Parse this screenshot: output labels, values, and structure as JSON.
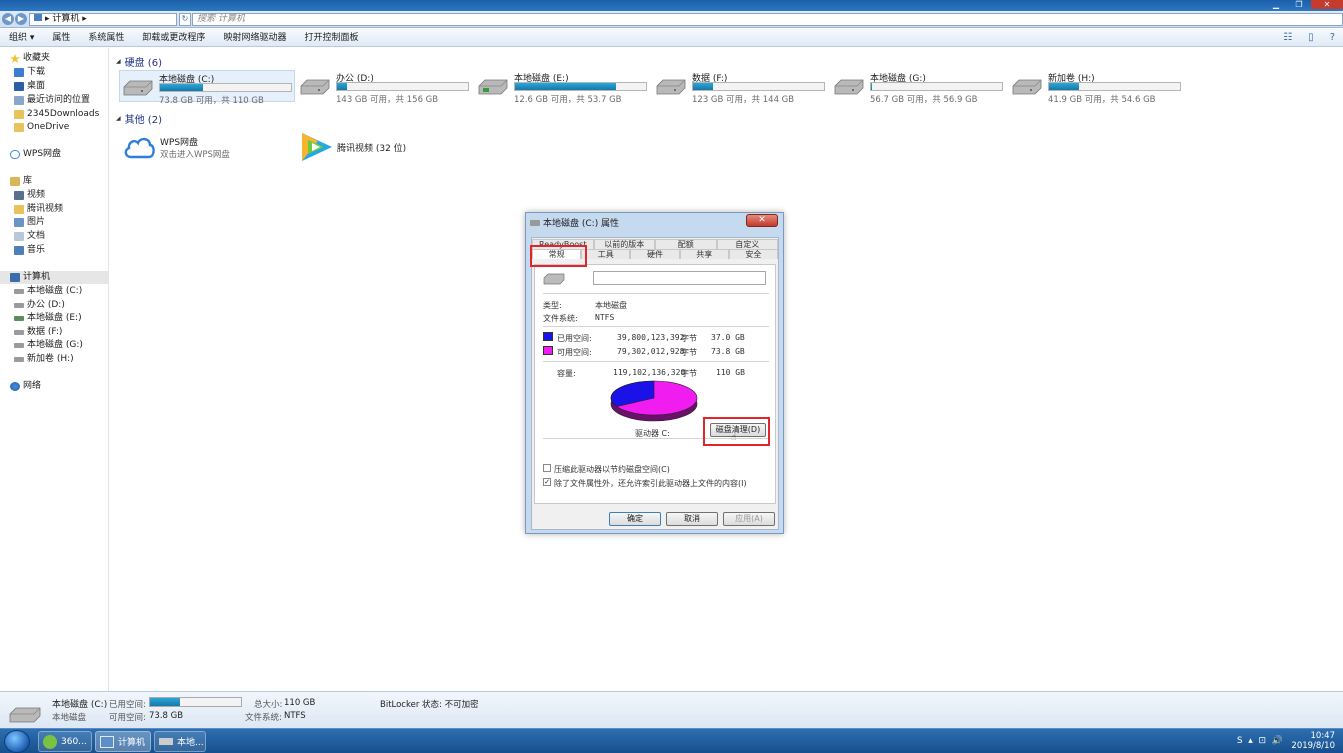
{
  "window": {
    "minimize": "▁",
    "restore": "❐",
    "close": "✕"
  },
  "address": {
    "breadcrumb": "▸ 计算机 ▸",
    "search_placeholder": "搜索 计算机"
  },
  "toolbar": {
    "items": [
      "组织 ▾",
      "属性",
      "系统属性",
      "卸载或更改程序",
      "映射网络驱动器",
      "打开控制面板"
    ]
  },
  "sidebar": {
    "favorites": "收藏夹",
    "fav_items": [
      "下载",
      "桌面",
      "最近访问的位置",
      "2345Downloads",
      "OneDrive"
    ],
    "wps": "WPS网盘",
    "library": "库",
    "lib_items": [
      "视频",
      "腾讯视频",
      "图片",
      "文档",
      "音乐"
    ],
    "computer": "计算机",
    "drives": [
      "本地磁盘 (C:)",
      "办公 (D:)",
      "本地磁盘 (E:)",
      "数据 (F:)",
      "本地磁盘 (G:)",
      "新加卷 (H:)"
    ],
    "network": "网络"
  },
  "main": {
    "hdd_header": "硬盘 (6)",
    "other_header": "其他 (2)",
    "drives": [
      {
        "name": "本地磁盘 (C:)",
        "free": "73.8 GB 可用，共 110 GB",
        "used_fraction": 0.33
      },
      {
        "name": "办公 (D:)",
        "free": "143 GB 可用，共 156 GB",
        "used_fraction": 0.08
      },
      {
        "name": "本地磁盘 (E:)",
        "free": "12.6 GB 可用，共 53.7 GB",
        "used_fraction": 0.77
      },
      {
        "name": "数据 (F:)",
        "free": "123 GB 可用，共 144 GB",
        "used_fraction": 0.15
      },
      {
        "name": "本地磁盘 (G:)",
        "free": "56.7 GB 可用，共 56.9 GB",
        "used_fraction": 0.01
      },
      {
        "name": "新加卷 (H:)",
        "free": "41.9 GB 可用，共 54.6 GB",
        "used_fraction": 0.23
      }
    ],
    "others": [
      {
        "name": "WPS网盘",
        "sub": "双击进入WPS网盘"
      },
      {
        "name": "腾讯视频 (32 位)",
        "sub": ""
      }
    ]
  },
  "dialog": {
    "title": "本地磁盘 (C:) 属性",
    "close": "✕",
    "tabs_top": [
      "ReadyBoost",
      "以前的版本",
      "配额",
      "自定义"
    ],
    "tabs_bottom": [
      "常规",
      "工具",
      "硬件",
      "共享",
      "安全"
    ],
    "type_label": "类型:",
    "type_value": "本地磁盘",
    "fs_label": "文件系统:",
    "fs_value": "NTFS",
    "used_label": "已用空间:",
    "used_bytes": "39,800,123,392",
    "used_unit": "字节",
    "used_gb": "37.0 GB",
    "free_label": "可用空间:",
    "free_bytes": "79,302,012,928",
    "free_unit": "字节",
    "free_gb": "73.8 GB",
    "cap_label": "容量:",
    "cap_bytes": "119,102,136,320",
    "cap_unit": "字节",
    "cap_gb": "110 GB",
    "drive_label": "驱动器 C:",
    "cleanup": "磁盘清理(D)",
    "compress": "压缩此驱动器以节约磁盘空间(C)",
    "index": "除了文件属性外，还允许索引此驱动器上文件的内容(I)",
    "index_checked": "✓",
    "ok": "确定",
    "cancel": "取消",
    "apply": "应用(A)",
    "used_color": "#1a12e6",
    "free_color": "#f01cf0",
    "used_share": 0.334
  },
  "status": {
    "name": "本地磁盘 (C:)",
    "kind": "本地磁盘",
    "used_label": "已用空间:",
    "free_label": "可用空间:",
    "free_value": "73.8 GB",
    "total_label": "总大小:",
    "total_value": "110 GB",
    "fs_label": "文件系统:",
    "fs_value": "NTFS",
    "bitlocker": "BitLocker 状态: 不可加密",
    "used_fraction": 0.33
  },
  "taskbar": {
    "items": [
      "360...",
      "计算机",
      "本地..."
    ],
    "time": "10:47",
    "date": "2019/8/10",
    "tray_icons": "S  ▴  ⊡  🔊"
  }
}
